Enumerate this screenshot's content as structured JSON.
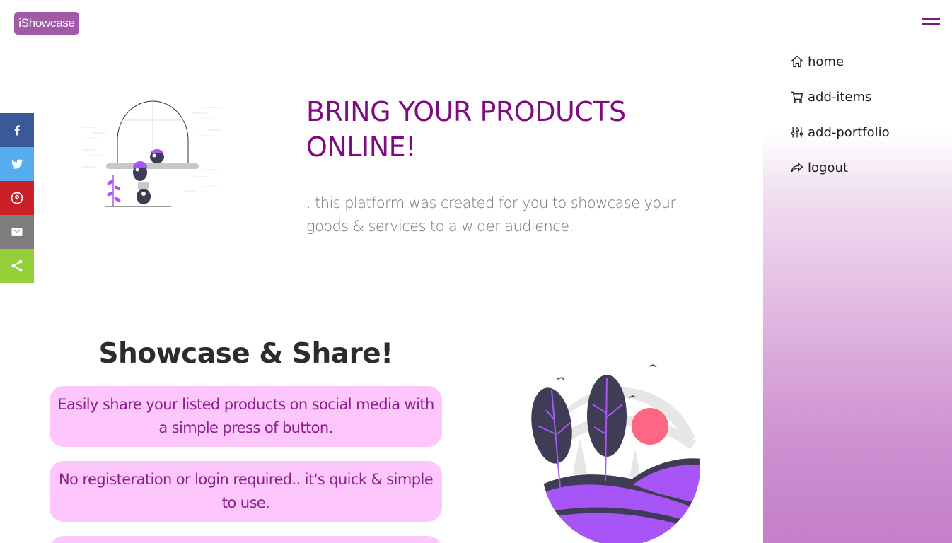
{
  "header": {
    "logo": "iShowcase",
    "menu_icon": "hamburger-icon",
    "accent": "#7a1a7a"
  },
  "sidebar": {
    "items": [
      {
        "label": "home",
        "icon": "home-icon"
      },
      {
        "label": "add-items",
        "icon": "cart-icon"
      },
      {
        "label": "add-portfolio",
        "icon": "sliders-icon"
      },
      {
        "label": "logout",
        "icon": "share-arrow-icon"
      }
    ]
  },
  "social": [
    {
      "name": "facebook",
      "icon": "facebook-icon",
      "color": "#3b5998"
    },
    {
      "name": "twitter",
      "icon": "twitter-icon",
      "color": "#55acee"
    },
    {
      "name": "pinterest",
      "icon": "pinterest-icon",
      "color": "#cb2027"
    },
    {
      "name": "email",
      "icon": "email-icon",
      "color": "#7d7d7d"
    },
    {
      "name": "share",
      "icon": "share-icon",
      "color": "#95d03a"
    }
  ],
  "hero": {
    "title": "BRING YOUR PRODUCTS ONLINE!",
    "subtitle": "..this platform was created for you to showcase your goods & services to a wider audience.",
    "title_color": "#800a80"
  },
  "features": {
    "title": "Showcase & Share!",
    "cards": [
      "Easily share your listed products on social media with a simple press of button.",
      "No registeration or login required.. it's quick & simple to use.",
      ""
    ],
    "card_color": "#fdc6fc"
  }
}
